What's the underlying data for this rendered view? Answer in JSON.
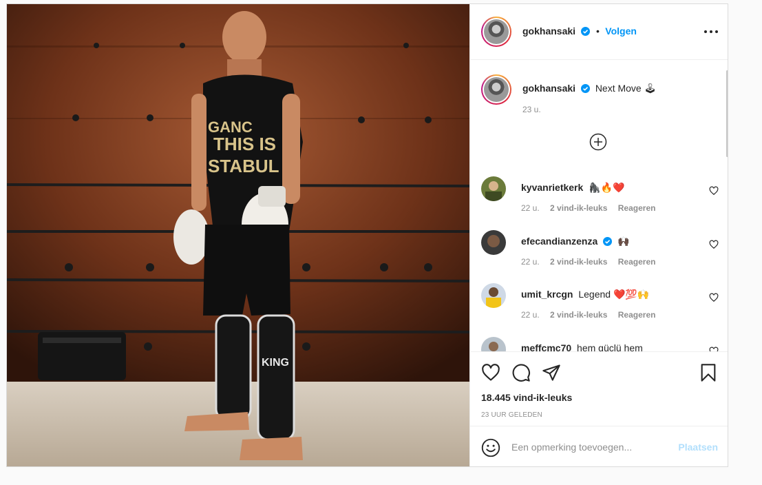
{
  "post": {
    "image_alt": "",
    "author": "gokhansaki",
    "verified": true,
    "follow_label": "Volgen",
    "separator": "•"
  },
  "caption": {
    "username": "gokhansaki",
    "text": "Next Move 🕹",
    "time": "23 u."
  },
  "comments": [
    {
      "username": "kyvanrietkerk",
      "text": "🦍🔥❤️",
      "time": "22 u.",
      "likes": "2 vind-ik-leuks",
      "reply": "Reageren",
      "verified": false
    },
    {
      "username": "efecandianzenza",
      "text": "🙌🏿",
      "time": "22 u.",
      "likes": "2 vind-ik-leuks",
      "reply": "Reageren",
      "verified": true
    },
    {
      "username": "umit_krcgn",
      "text": "Legend ❤️💯🙌",
      "time": "22 u.",
      "likes": "2 vind-ik-leuks",
      "reply": "Reageren",
      "verified": false
    },
    {
      "username": "meffcmc70",
      "text": "hem güçlü hem",
      "time": "",
      "likes": "",
      "reply": "",
      "verified": false
    }
  ],
  "actions": {
    "like_count": "18.445 vind-ik-leuks",
    "timestamp": "23 UUR GELEDEN"
  },
  "composer": {
    "placeholder": "Een opmerking toevoegen...",
    "submit_label": "Plaatsen"
  },
  "colors": {
    "accent": "#0095f6",
    "submit_disabled": "#b2dffc",
    "text": "#262626",
    "muted": "#8e8e8e",
    "border": "#dbdbdb"
  }
}
